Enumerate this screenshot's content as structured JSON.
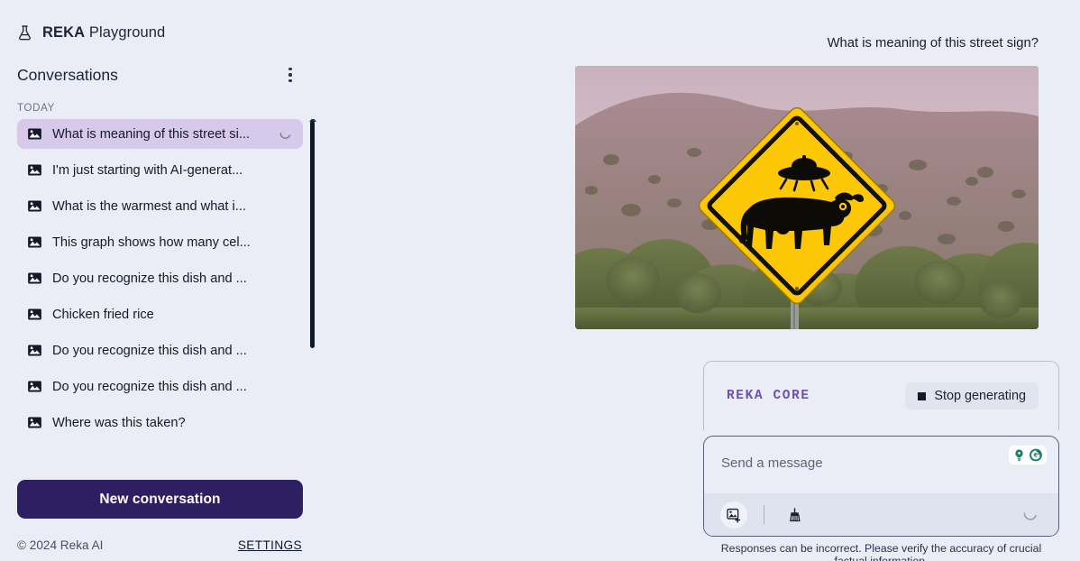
{
  "brand": {
    "icon": "flask-icon",
    "name": "REKA",
    "suffix": "Playground"
  },
  "sidebar": {
    "conversations_title": "Conversations",
    "menu_icon": "kebab-menu-icon",
    "group_label": "TODAY",
    "items": [
      {
        "label": "What is meaning of this street si...",
        "icon": "image-icon",
        "selected": true,
        "loading": true
      },
      {
        "label": "I'm just starting with AI-generat...",
        "icon": "image-icon",
        "selected": false,
        "loading": false
      },
      {
        "label": "What is the warmest and what i...",
        "icon": "image-icon",
        "selected": false,
        "loading": false
      },
      {
        "label": "This graph shows how many cel...",
        "icon": "image-icon",
        "selected": false,
        "loading": false
      },
      {
        "label": "Do you recognize this dish and ...",
        "icon": "image-icon",
        "selected": false,
        "loading": false
      },
      {
        "label": "Chicken fried rice",
        "icon": "image-icon",
        "selected": false,
        "loading": false
      },
      {
        "label": "Do you recognize this dish and ...",
        "icon": "image-icon",
        "selected": false,
        "loading": false
      },
      {
        "label": "Do you recognize this dish and ...",
        "icon": "image-icon",
        "selected": false,
        "loading": false
      },
      {
        "label": "Where was this taken?",
        "icon": "image-icon",
        "selected": false,
        "loading": false
      }
    ],
    "new_conversation_label": "New conversation",
    "copyright": "© 2024 Reka AI",
    "settings_label": "SETTINGS"
  },
  "main": {
    "user_message": "What is meaning of this street sign?",
    "attachment_alt": "yellow diamond road sign with cow and UFO silhouette",
    "model_name": "REKA CORE",
    "stop_label": "Stop generating",
    "stop_icon": "stop-square-icon",
    "composer_placeholder": "Send a message",
    "attach_image_icon": "add-image-icon",
    "clear_icon": "broom-icon",
    "grammarly_icons": [
      "lightbulb-icon",
      "grammarly-g-icon"
    ],
    "loading_icon": "spinner-icon",
    "disclaimer": "Responses can be incorrect. Please verify the accuracy of crucial factual information."
  },
  "colors": {
    "page_bg": "#eaedf6",
    "selected_item": "#d7c9ea",
    "primary_button": "#2e1f63",
    "model_accent": "#6f4fb3",
    "sign_yellow": "#fbc707",
    "grammarly_green": "#15806a"
  }
}
